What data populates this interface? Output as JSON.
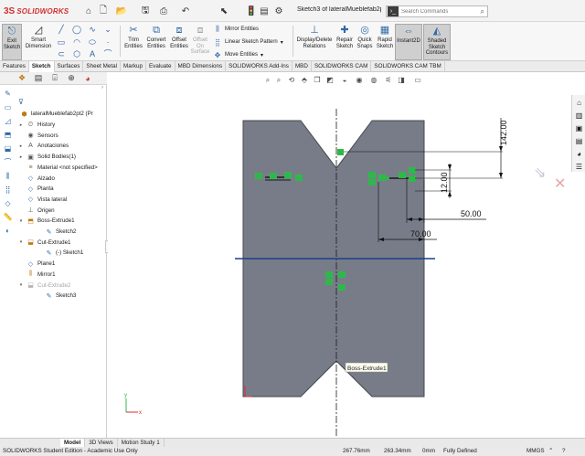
{
  "app": {
    "logo_text": "SOLIDWORKS",
    "logo_mark": "3S"
  },
  "quick_access": [
    {
      "name": "home-icon",
      "glyph": "⌂"
    },
    {
      "name": "new-document-icon",
      "glyph": "🗋"
    },
    {
      "name": "open-icon",
      "glyph": "📂"
    },
    {
      "name": "save-icon",
      "glyph": "🖫"
    },
    {
      "name": "print-icon",
      "glyph": "⎙"
    },
    {
      "name": "undo-icon",
      "glyph": "↶"
    },
    {
      "name": "select-icon",
      "glyph": "⬉"
    },
    {
      "name": "rebuild-icon",
      "glyph": "🚦"
    },
    {
      "name": "file-properties-icon",
      "glyph": "▤"
    },
    {
      "name": "options-icon",
      "glyph": "⚙"
    }
  ],
  "window": {
    "title": "Sketch3 of lateralMueblefab2pt..."
  },
  "search": {
    "placeholder": "Search Commands"
  },
  "ribbon": {
    "exit_sketch": {
      "line1": "Exit",
      "line2": "Sketch"
    },
    "smart_dimension": {
      "line1": "Smart",
      "line2": "Dimension"
    },
    "trim_entities": {
      "line1": "Trim",
      "line2": "Entities"
    },
    "convert_entities": {
      "line1": "Convert",
      "line2": "Entities"
    },
    "offset_entities": {
      "line1": "Offset",
      "line2": "Entities"
    },
    "offset_on_surface": {
      "line1": "Offset",
      "line2": "On",
      "line3": "Surface"
    },
    "mirror_entities": "Mirror Entities",
    "linear_sketch_pattern": "Linear Sketch Pattern",
    "move_entities": "Move Entities",
    "display_delete_relations": {
      "line1": "Display/Delete",
      "line2": "Relations"
    },
    "repair_sketch": {
      "line1": "Repair",
      "line2": "Sketch"
    },
    "quick_snaps": {
      "line1": "Quick",
      "line2": "Snaps"
    },
    "rapid_sketch": {
      "line1": "Rapid",
      "line2": "Sketch"
    },
    "instant2d": "Instant2D",
    "shaded_sketch_contours": {
      "line1": "Shaded",
      "line2": "Sketch",
      "line3": "Contours"
    }
  },
  "tabs": [
    "Features",
    "Sketch",
    "Surfaces",
    "Sheet Metal",
    "Markup",
    "Evaluate",
    "MBD Dimensions",
    "SOLIDWORKS Add-Ins",
    "MBD",
    "SOLIDWORKS CAM",
    "SOLIDWORKS CAM TBM"
  ],
  "active_tab": "Sketch",
  "tree": {
    "root": "lateralMueblefab2pt2 (Pr",
    "items": [
      {
        "label": "History",
        "expander": "▸",
        "icon": "history-icon"
      },
      {
        "label": "Sensors",
        "expander": "",
        "icon": "sensor-icon"
      },
      {
        "label": "Anotaciones",
        "expander": "▸",
        "icon": "annotation-icon"
      },
      {
        "label": "Solid Bodies(1)",
        "expander": "▸",
        "icon": "solid-bodies-icon"
      },
      {
        "label": "Material <not specified>",
        "expander": "",
        "icon": "material-icon"
      },
      {
        "label": "Alzado",
        "expander": "",
        "icon": "plane-icon"
      },
      {
        "label": "Planta",
        "expander": "",
        "icon": "plane-icon"
      },
      {
        "label": "Vista lateral",
        "expander": "",
        "icon": "plane-icon"
      },
      {
        "label": "Origen",
        "expander": "",
        "icon": "origin-icon"
      },
      {
        "label": "Boss-Extrude1",
        "expander": "▾",
        "icon": "extrude-icon"
      },
      {
        "label": "Sketch2",
        "expander": "",
        "icon": "sketch-icon"
      },
      {
        "label": "Cut-Extrude1",
        "expander": "▾",
        "icon": "cut-extrude-icon"
      },
      {
        "label": "(-) Sketch1",
        "expander": "",
        "icon": "sketch-icon"
      },
      {
        "label": "Plane1",
        "expander": "",
        "icon": "plane-icon"
      },
      {
        "label": "Mirror1",
        "expander": "",
        "icon": "mirror-icon"
      },
      {
        "label": "Cut-Extrude2",
        "expander": "▾",
        "icon": "cut-extrude-icon",
        "dim": true
      },
      {
        "label": "Sketch3",
        "expander": "",
        "icon": "sketch-icon"
      }
    ]
  },
  "graphics": {
    "dimensions": [
      "142.00",
      "12.00",
      "50.00",
      "70.00"
    ],
    "relation_tags": [
      "≠",
      "⊥",
      "—",
      "∥",
      "≡"
    ],
    "tooltip": "Boss-Extrude1"
  },
  "bottom_tabs": [
    "Model",
    "3D Views",
    "Motion Study 1"
  ],
  "active_bottom_tab": "Model",
  "status": {
    "edition": "SOLIDWORKS Student Edition - Academic Use Only",
    "x": "267.76mm",
    "y": "263.34mm",
    "z": "0mm",
    "state": "Fully Defined",
    "units": "MMGS"
  },
  "colors": {
    "part_face": "#787c88",
    "part_edge": "#45474d",
    "sketch_line": "#1b3f8c",
    "relation_green": "#2fb84a",
    "dimension": "#111111",
    "logo_red": "#d32f2f"
  }
}
